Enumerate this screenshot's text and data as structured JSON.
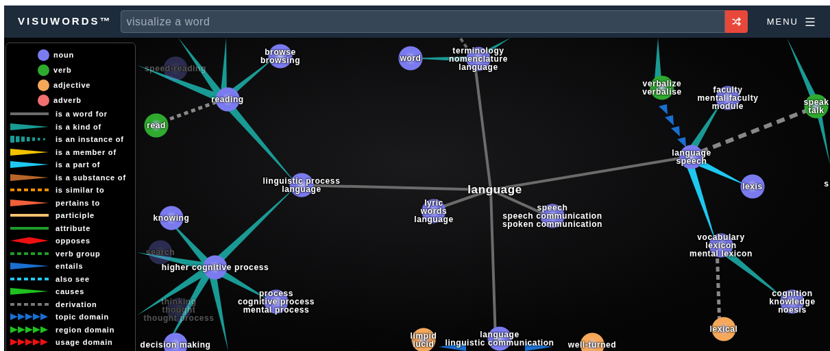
{
  "header": {
    "logo": "VISUWORDS™",
    "search": {
      "placeholder": "visualize a word"
    },
    "menu_label": "MENU"
  },
  "legend": {
    "parts_of_speech": [
      {
        "label": "noun",
        "color": "#7b7bf0"
      },
      {
        "label": "verb",
        "color": "#2faa2f"
      },
      {
        "label": "adjective",
        "color": "#f5a85a"
      },
      {
        "label": "adverb",
        "color": "#f07070"
      }
    ],
    "relations": [
      {
        "label": "is a word for",
        "kind": "line",
        "color": "#6b6b6b"
      },
      {
        "label": "is a kind of",
        "kind": "taper",
        "color": "#1a9a94"
      },
      {
        "label": "is an instance of",
        "kind": "dashed-taper",
        "color": "#1a9a94"
      },
      {
        "label": "is a member of",
        "kind": "taper",
        "color": "#f2c200"
      },
      {
        "label": "is a part of",
        "kind": "taper",
        "color": "#1ec8f0"
      },
      {
        "label": "is a substance of",
        "kind": "taper",
        "color": "#b8652a"
      },
      {
        "label": "is similar to",
        "kind": "dots",
        "color": "#f08c00"
      },
      {
        "label": "pertains to",
        "kind": "taper",
        "color": "#f0603a"
      },
      {
        "label": "participle",
        "kind": "line",
        "color": "#f5c070"
      },
      {
        "label": "attribute",
        "kind": "line",
        "color": "#1f9a2a"
      },
      {
        "label": "opposes",
        "kind": "diamond",
        "color": "#ee1111"
      },
      {
        "label": "verb group",
        "kind": "dots",
        "color": "#1f9a2a"
      },
      {
        "label": "entails",
        "kind": "taper",
        "color": "#1a6fd0"
      },
      {
        "label": "also see",
        "kind": "dots",
        "color": "#20c8f0"
      },
      {
        "label": "causes",
        "kind": "taper",
        "color": "#1fc01f"
      },
      {
        "label": "derivation",
        "kind": "dots",
        "color": "#777777"
      },
      {
        "label": "topic domain",
        "kind": "arrows",
        "color": "#1a6fd0"
      },
      {
        "label": "region domain",
        "kind": "arrows",
        "color": "#1fc01f"
      },
      {
        "label": "usage domain",
        "kind": "arrows",
        "color": "#ee1111"
      }
    ]
  },
  "graph": {
    "nodes": [
      {
        "kind": "noun",
        "words": [
          "speed-reading"
        ],
        "dimmed": true
      },
      {
        "kind": "noun",
        "words": [
          "browse",
          "browsing"
        ],
        "dimmed": false
      },
      {
        "kind": "noun",
        "words": [
          "word"
        ],
        "dimmed": false
      },
      {
        "kind": "noun",
        "words": [
          "terminology",
          "nomenclature",
          "language"
        ],
        "dimmed": false
      },
      {
        "kind": "noun",
        "words": [
          "reading"
        ],
        "dimmed": false
      },
      {
        "kind": "verb",
        "words": [
          "verbalize",
          "verbalise"
        ],
        "dimmed": false
      },
      {
        "kind": "noun",
        "words": [
          "faculty",
          "mental faculty",
          "module"
        ],
        "dimmed": false
      },
      {
        "kind": "verb",
        "words": [
          "speak",
          "talk"
        ],
        "dimmed": false
      },
      {
        "kind": "verb",
        "words": [
          "read"
        ],
        "dimmed": false
      },
      {
        "kind": "noun",
        "words": [
          "language",
          "speech"
        ],
        "dimmed": false
      },
      {
        "kind": "noun",
        "words": [
          "linguistic process",
          "language"
        ],
        "dimmed": false
      },
      {
        "kind": "focus",
        "words": [
          "language"
        ],
        "dimmed": false
      },
      {
        "kind": "noun",
        "words": [
          "lexis"
        ],
        "dimmed": false
      },
      {
        "kind": "label",
        "words": [
          "s"
        ],
        "dimmed": false
      },
      {
        "kind": "noun",
        "words": [
          "knowing"
        ],
        "dimmed": false
      },
      {
        "kind": "noun",
        "words": [
          "lyric",
          "words",
          "language"
        ],
        "dimmed": false
      },
      {
        "kind": "noun",
        "words": [
          "speech",
          "speech communication",
          "spoken communication"
        ],
        "dimmed": false
      },
      {
        "kind": "noun",
        "words": [
          "search"
        ],
        "dimmed": true
      },
      {
        "kind": "noun",
        "words": [
          "vocabulary",
          "lexicon",
          "mental lexicon"
        ],
        "dimmed": false
      },
      {
        "kind": "noun",
        "words": [
          "higher cognitive process"
        ],
        "dimmed": false
      },
      {
        "kind": "noun",
        "words": [
          "thinking",
          "thought",
          "thought process"
        ],
        "dimmed": true
      },
      {
        "kind": "noun",
        "words": [
          "process",
          "cognitive process",
          "mental process"
        ],
        "dimmed": false
      },
      {
        "kind": "noun",
        "words": [
          "cognition",
          "knowledge",
          "noesis"
        ],
        "dimmed": false
      },
      {
        "kind": "noun",
        "words": [
          "decision making"
        ],
        "dimmed": false
      },
      {
        "kind": "adjective",
        "words": [
          "limpid",
          "lucid"
        ],
        "dimmed": false
      },
      {
        "kind": "noun",
        "words": [
          "language",
          "linguistic communication"
        ],
        "dimmed": false
      },
      {
        "kind": "adjective",
        "words": [
          "well-turned"
        ],
        "dimmed": false
      },
      {
        "kind": "adjective",
        "words": [
          "lexical"
        ],
        "dimmed": false
      }
    ]
  }
}
